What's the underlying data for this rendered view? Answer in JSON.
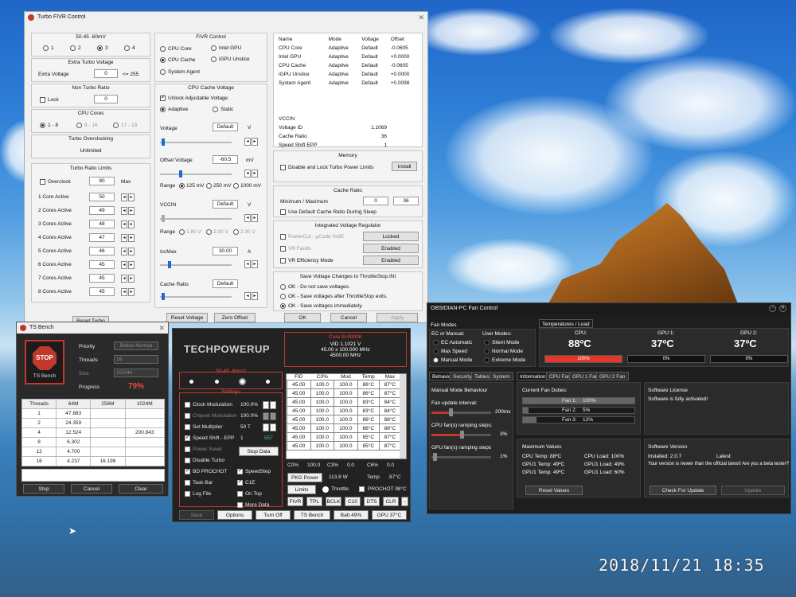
{
  "timestamp": "2018/11/21  18:35",
  "fivr": {
    "title": "Turbo FIVR Control",
    "ratio_label": "50-45 -60mV",
    "profiles": [
      "1",
      "2",
      "3",
      "4"
    ],
    "active_profile": 2,
    "extra_turbo_title": "Extra Turbo Voltage",
    "extra_voltage_label": "Extra Voltage",
    "extra_voltage_value": "0",
    "extra_voltage_max": "<= 255",
    "non_turbo_title": "Non Turbo Ratio",
    "lock_label": "Lock",
    "lock_value": "0",
    "cpu_cores_title": "CPU Cores",
    "cpu_core_opts": [
      "1 - 8",
      "9 - 16",
      "17 - 18"
    ],
    "turbo_oc_title": "Turbo Overclocking",
    "turbo_oc_value": "Unlimited",
    "turbo_ratio_title": "Turbo Ratio Limits",
    "overclock_label": "Overclock",
    "overclock_value": "80",
    "overclock_max": "Max",
    "cores": [
      {
        "label": "1 Core Active",
        "value": "50"
      },
      {
        "label": "2 Cores Active",
        "value": "49"
      },
      {
        "label": "3 Cores Active",
        "value": "48"
      },
      {
        "label": "4 Cores Active",
        "value": "47"
      },
      {
        "label": "5 Cores Active",
        "value": "46"
      },
      {
        "label": "6 Cores Active",
        "value": "45"
      },
      {
        "label": "7 Cores Active",
        "value": "45"
      },
      {
        "label": "8 Cores Active",
        "value": "45"
      }
    ],
    "fivr_control_title": "FIVR Control",
    "fivr_opts": [
      "CPU Core",
      "Intel GPU",
      "CPU Cache",
      "iGPU Unslice",
      "System Agent"
    ],
    "fivr_selected": 2,
    "cache_voltage_title": "CPU Cache Voltage",
    "unlock_label": "Unlock Adjustable Voltage",
    "adaptive_label": "Adaptive",
    "static_label": "Static",
    "voltage_label": "Voltage",
    "voltage_value": "Default",
    "voltage_unit": "V",
    "offset_label": "Offset Voltage",
    "offset_value": "-60.5",
    "offset_unit": "mV",
    "range_label": "Range",
    "range_opts": [
      "125 mV",
      "250 mV",
      "1000 mV"
    ],
    "vccin_label": "VCCIN",
    "vccin_value": "Default",
    "vccin_unit": "V",
    "vccin_range_opts": [
      "1.80 V",
      "2.00 V",
      "2.30 V"
    ],
    "iccmax_label": "IccMax",
    "iccmax_value": "30.00",
    "iccmax_unit": "A",
    "cache_ratio_label": "Cache Ratio",
    "cache_ratio_value": "Default",
    "status_headers": [
      "Name",
      "Mode",
      "Voltage",
      "Offset"
    ],
    "status_rows": [
      [
        "CPU Core",
        "Adaptive",
        "Default",
        "-0.0605"
      ],
      [
        "Intel GPU",
        "Adaptive",
        "Default",
        "+0.0000"
      ],
      [
        "CPU Cache",
        "Adaptive",
        "Default",
        "-0.0605"
      ],
      [
        "iGPU Unslice",
        "Adaptive",
        "Default",
        "+0.0000"
      ],
      [
        "System Agent",
        "Adaptive",
        "Default",
        "+0.0098"
      ]
    ],
    "vccin_info": [
      [
        "VCCIN",
        ""
      ],
      [
        "Voltage ID",
        "1.1069"
      ],
      [
        "Cache Ratio",
        "36"
      ],
      [
        "Speed Shift EPP",
        "1"
      ]
    ],
    "memory_title": "Memory",
    "disable_lock_label": "Disable and Lock Turbo Power Limits",
    "install_label": "Install",
    "cache_ratio_title": "Cache Ratio",
    "minmax_label": "Minimum / Maximum",
    "min_value": "0",
    "max_value": "36",
    "use_default_label": "Use Default Cache Ratio During Sleep",
    "ivr_title": "Integrated Voltage Regulator",
    "ivr_rows": [
      [
        "PowerCut - µCode 0x9E",
        "Locked"
      ],
      [
        "VR Faults",
        "Enabled"
      ],
      [
        "VR Efficiency Mode",
        "Enabled"
      ]
    ],
    "save_title": "Save Voltage Changes to ThrottleStop.INI",
    "save_opts": [
      "OK - Do not save voltages.",
      "OK - Save voltages after ThrottleStop exits.",
      "OK - Save voltages immediately."
    ],
    "save_selected": 2,
    "buttons": [
      "Reset Voltage",
      "Zero Offset",
      "OK",
      "Cancel",
      "Apply"
    ],
    "reset_turbo_label": "Reset Turbo"
  },
  "bench": {
    "title": "TS Bench",
    "stop_icon_text": "STOP",
    "stop_sub": "TS Bench",
    "priority_label": "Priority",
    "priority_value": "Below Normal",
    "threads_label": "Threads",
    "threads_value": "16",
    "size_label": "Size",
    "size_value": "1024M",
    "progress_label": "Progress",
    "progress_value": "79%",
    "headers": [
      "Threads",
      "64M",
      "256M",
      "1024M"
    ],
    "rows": [
      [
        "1",
        "47.883",
        "",
        ""
      ],
      [
        "2",
        "24.359",
        "",
        ""
      ],
      [
        "4",
        "12.524",
        "",
        "200.843"
      ],
      [
        "8",
        "6.302",
        "",
        ""
      ],
      [
        "12",
        "4.700",
        "",
        ""
      ],
      [
        "16",
        "4.237",
        "16.198",
        ""
      ]
    ],
    "buttons": [
      "Stop",
      "Cancel",
      "Clear"
    ]
  },
  "ts": {
    "logo": "TECHPOWERUP",
    "profile_label": "50-45 -60mV",
    "settings_label": "Settings",
    "cpu_name": "Core i9-9900K",
    "vid": "VID  1.1021 V",
    "freq": "45.00 x 100.000 MHz",
    "freq2": "4500.00 MHz",
    "opts": [
      {
        "label": "Clock Modulation",
        "val": "100.0%",
        "on": false
      },
      {
        "label": "Chipset Modulation",
        "val": "100.0%",
        "on": false
      },
      {
        "label": "Set Multiplier",
        "val": "50 T",
        "on": false
      },
      {
        "label": "Speed Shift - EPP",
        "val": "1",
        "on": true
      },
      {
        "label": "Power Saver",
        "val": "",
        "on": false
      },
      {
        "label": "Disable Turbo",
        "val": "",
        "on": false
      },
      {
        "label": "BD PROCHOT",
        "val": "",
        "on": true
      },
      {
        "label": "Task Bar",
        "val": "",
        "on": false
      },
      {
        "label": "Log File",
        "val": "",
        "on": false
      }
    ],
    "epp_extra": "557",
    "stop_data": "Stop Data",
    "right_opts": [
      {
        "label": "SpeedStep",
        "on": true
      },
      {
        "label": "C1E",
        "on": true
      },
      {
        "label": "On Top",
        "on": false
      },
      {
        "label": "More Data",
        "on": false
      }
    ],
    "table_headers": [
      "FID",
      "C0%",
      "Mod",
      "Temp",
      "Max"
    ],
    "table_rows": [
      [
        "45.00",
        "100.0",
        "100.0",
        "86°C",
        "87°C"
      ],
      [
        "45.00",
        "100.0",
        "100.0",
        "86°C",
        "87°C"
      ],
      [
        "45.00",
        "100.0",
        "100.0",
        "83°C",
        "84°C"
      ],
      [
        "45.00",
        "100.0",
        "100.0",
        "83°C",
        "84°C"
      ],
      [
        "45.00",
        "100.0",
        "100.0",
        "86°C",
        "88°C"
      ],
      [
        "45.00",
        "100.0",
        "100.0",
        "86°C",
        "88°C"
      ],
      [
        "45.00",
        "100.0",
        "100.0",
        "85°C",
        "87°C"
      ],
      [
        "45.00",
        "100.0",
        "100.0",
        "85°C",
        "87°C"
      ]
    ],
    "summary": [
      "C0%",
      "100.0",
      "C3%",
      "0.0",
      "C6%",
      "0.0"
    ],
    "pkg_label": "PKG Power",
    "pkg_value": "113.8 W",
    "temp_label": "Temp",
    "temp_value": "87°C",
    "limits_label": "Limits",
    "throttle_label": "Throttle",
    "prochot_label": "PROCHOT 98°C",
    "bottom_buttons": [
      "FIVR",
      "TPL",
      "BCLK",
      "C10",
      "DTS",
      "CLR"
    ],
    "footer_buttons": [
      "Save",
      "Options",
      "Turn Off",
      "TS Bench",
      "Batt 49%",
      "GPU 37°C"
    ]
  },
  "fan": {
    "title": "OBSIDIAN-PC Fan Control",
    "modes_title": "Fan Modes",
    "ec_label": "EC or Manual:",
    "ec_opts": [
      "EC Automatic",
      "Max Speed",
      "Manual Mode"
    ],
    "user_label": "User Modes:",
    "user_opts": [
      "Silent Mode",
      "Normal Mode",
      "Extreme Mode"
    ],
    "temps_tab": "Temperatures / Load",
    "temps": [
      {
        "label": "CPU:",
        "value": "88ºC",
        "load": "100%",
        "pct": 100
      },
      {
        "label": "GPU 1:",
        "value": "37ºC",
        "load": "0%",
        "pct": 0
      },
      {
        "label": "GPU 2:",
        "value": "37ºC",
        "load": "0%",
        "pct": 0
      }
    ],
    "left_tabs": [
      "Behavior",
      "Security",
      "Tables",
      "System"
    ],
    "right_tabs": [
      "Information",
      "CPU Fan",
      "GPU 1 Fan",
      "GPU 2 Fan"
    ],
    "manual_title": "Manual Mode Behaviour",
    "interval_label": "Fan update interval:",
    "interval_value": "200ms",
    "cpu_ramp_label": "CPU fan(s) ramping steps:",
    "cpu_ramp_value": "3%",
    "gpu_ramp_label": "GPU fan(s) ramping steps",
    "gpu_ramp_value": "1%",
    "duties_title": "Current Fan Duties:",
    "duties": [
      {
        "label": "Fan 1:",
        "value": "100%",
        "pct": 100
      },
      {
        "label": "Fan 2:",
        "value": "5%",
        "pct": 5
      },
      {
        "label": "Fan 3:",
        "value": "12%",
        "pct": 12
      }
    ],
    "license_title": "Software License",
    "license_text": "Software is fully activated!",
    "max_title": "Maximum Values",
    "max_left": [
      "CPU Temp: 88ºC",
      "GPU1 Temp: 49ºC",
      "GPU1 Temp: 49ºC"
    ],
    "max_right": [
      "CPU Load: 100%",
      "GPU1 Load: 49%",
      "GPU1 Load: 60%"
    ],
    "version_title": "Software Version",
    "installed": "Installed: 2.0.7",
    "latest": "Latest:",
    "version_note": "Your version is newer than the official latest! Are you a beta tester?",
    "reset_values": "Reset Values",
    "check_update": "Check For Update",
    "update": "Update"
  }
}
